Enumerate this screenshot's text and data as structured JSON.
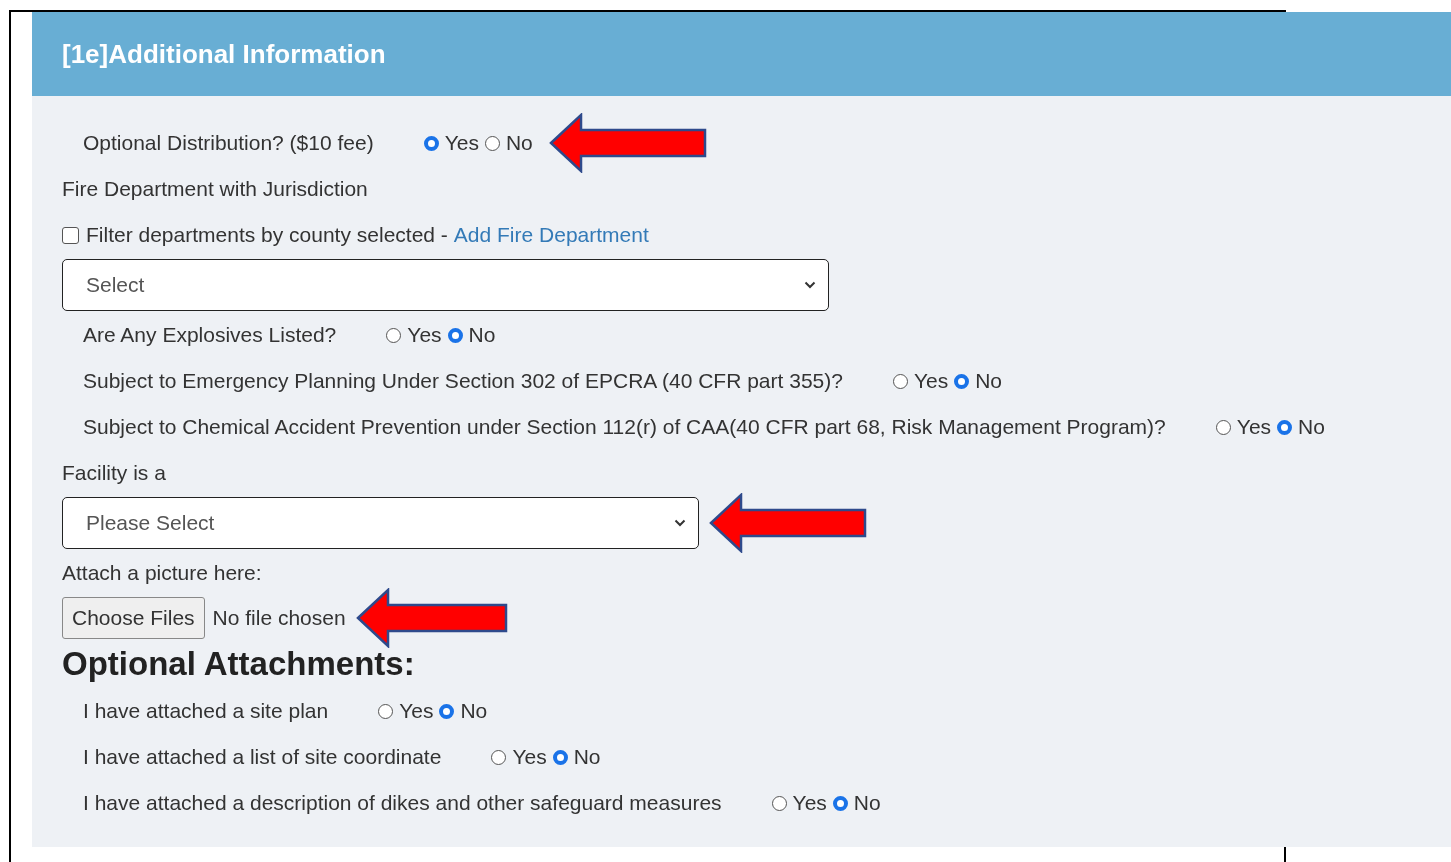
{
  "panel": {
    "title": "[1e]Additional Information"
  },
  "fields": [
    {
      "kind": "radio",
      "label": "Optional Distribution? ($10 fee)",
      "options": [
        {
          "label": "Yes",
          "selected": true
        },
        {
          "label": "No",
          "selected": false
        }
      ],
      "annotated": true
    },
    {
      "kind": "label",
      "label": "Fire Department with Jurisdiction"
    },
    {
      "kind": "checkbox",
      "label": "Filter departments by county selected -",
      "checked": false,
      "link": "Add Fire Department"
    },
    {
      "kind": "select",
      "value": "Select",
      "annotated": false
    },
    {
      "kind": "radio",
      "label": "Are Any Explosives Listed?",
      "options": [
        {
          "label": "Yes",
          "selected": false
        },
        {
          "label": "No",
          "selected": true
        }
      ],
      "annotated": false
    },
    {
      "kind": "radio",
      "label": "Subject to Emergency Planning Under Section 302 of EPCRA (40 CFR part 355)?",
      "options": [
        {
          "label": "Yes",
          "selected": false
        },
        {
          "label": "No",
          "selected": true
        }
      ],
      "annotated": false
    },
    {
      "kind": "radio",
      "label": "Subject to Chemical Accident Prevention under Section 112(r) of CAA(40 CFR part 68, Risk Management Program)?",
      "options": [
        {
          "label": "Yes",
          "selected": false
        },
        {
          "label": "No",
          "selected": true
        }
      ],
      "annotated": false
    },
    {
      "kind": "label",
      "label": "Facility is a"
    },
    {
      "kind": "select",
      "value": "Please Select",
      "annotated": true
    },
    {
      "kind": "label",
      "label": "Attach a picture here:"
    },
    {
      "kind": "file",
      "button": "Choose Files",
      "status": "No file chosen",
      "annotated": true
    },
    {
      "kind": "heading",
      "label": "Optional Attachments:"
    },
    {
      "kind": "radio",
      "label": "I have attached a site plan",
      "options": [
        {
          "label": "Yes",
          "selected": false
        },
        {
          "label": "No",
          "selected": true
        }
      ],
      "annotated": false
    },
    {
      "kind": "radio",
      "label": "I have attached a list of site coordinate",
      "options": [
        {
          "label": "Yes",
          "selected": false
        },
        {
          "label": "No",
          "selected": true
        }
      ],
      "annotated": false
    },
    {
      "kind": "radio",
      "label": "I have attached a description of dikes and other safeguard measures",
      "options": [
        {
          "label": "Yes",
          "selected": false
        },
        {
          "label": "No",
          "selected": true
        }
      ],
      "annotated": false
    }
  ]
}
